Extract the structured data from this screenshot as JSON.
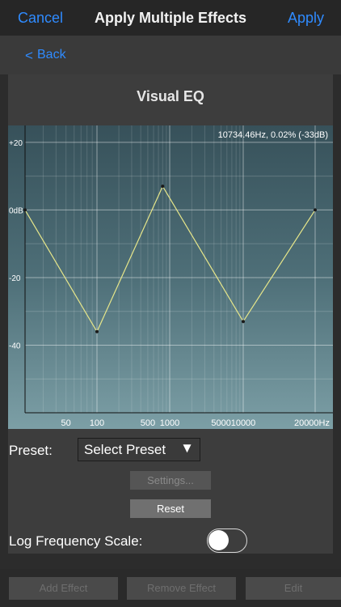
{
  "nav": {
    "cancel": "Cancel",
    "title": "Apply Multiple Effects",
    "apply": "Apply"
  },
  "back": {
    "chevron": "<",
    "label": "Back"
  },
  "section_title": "Visual EQ",
  "chart_data": {
    "type": "line",
    "readout": "10734.46Hz, 0.02% (-33dB)",
    "x_tick_labels": [
      "50",
      "100",
      "500",
      "1000",
      "5000",
      "10000",
      "20000Hz"
    ],
    "y_tick_labels": [
      "+20",
      "0dB",
      "-20",
      "-40"
    ],
    "ylim": [
      -60,
      25
    ],
    "grid": true,
    "series": [
      {
        "points": [
          [
            20,
            0
          ],
          [
            100,
            -36
          ],
          [
            800,
            7
          ],
          [
            10000,
            -33
          ],
          [
            20000,
            0
          ]
        ],
        "color": "#e6e68a"
      }
    ]
  },
  "preset": {
    "label": "Preset:",
    "value": "Select Preset",
    "arrow": "▼"
  },
  "buttons": {
    "settings": "Settings...",
    "reset": "Reset"
  },
  "log_scale": {
    "label": "Log Frequency Scale:",
    "on": false
  },
  "bottom": {
    "add": "Add Effect",
    "remove": "Remove Effect",
    "edit": "Edit"
  }
}
